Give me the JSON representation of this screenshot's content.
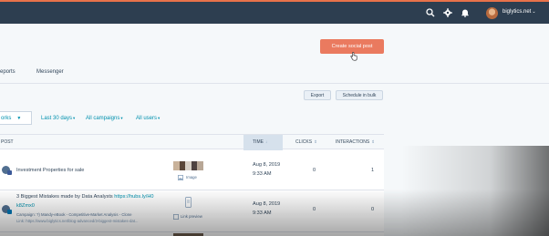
{
  "header": {
    "account_name": "biglytics.net",
    "account_chevron": "⌄",
    "icons": [
      "search-icon",
      "gear-icon",
      "bell-icon"
    ],
    "colors": {
      "bar": "#2d3e50",
      "accent_line": "#e8724a"
    }
  },
  "primary_action": {
    "label": "Create social post",
    "color": "#ea7a5f"
  },
  "tabs": [
    {
      "label": "eports"
    },
    {
      "label": "Messenger"
    }
  ],
  "toolbar": {
    "export_label": "Export",
    "schedule_label": "Schedule in bulk"
  },
  "filters": {
    "network_select": "orks",
    "network_caret": "▼",
    "date_range": "Last 30 days",
    "campaign": "All campaigns",
    "users": "All users",
    "chevron": "▾"
  },
  "table": {
    "columns": {
      "post": "POST",
      "time": "TIME",
      "time_sort": "↓",
      "clicks": "CLICKS",
      "interactions": "INTERACTIONS",
      "sort": "⇕"
    },
    "rows": [
      {
        "title": "Investment Properties for sale",
        "network": "facebook",
        "preview_label": "Image",
        "date": "Aug 8, 2019",
        "time": "9:33 AM",
        "clicks": "0",
        "interactions": "1"
      },
      {
        "title_prefix": "3 Biggest Mistakes made by Data Analysts",
        "title_link1": "https://hubs.ly/H0",
        "title_link2": "k8Zmx0",
        "campaign_line": "Campaign: ?) Mandy-eBook - Competitive-Market Analysis - Clone",
        "url_line": "Link: https://www.biglytics.net/blog-advanced/3-biggest-mistakes-dat...",
        "network": "linkedin",
        "preview_label": "Link preview",
        "date": "Aug 8, 2019",
        "time": "9:33 AM",
        "clicks": "0",
        "interactions": "0"
      }
    ]
  }
}
